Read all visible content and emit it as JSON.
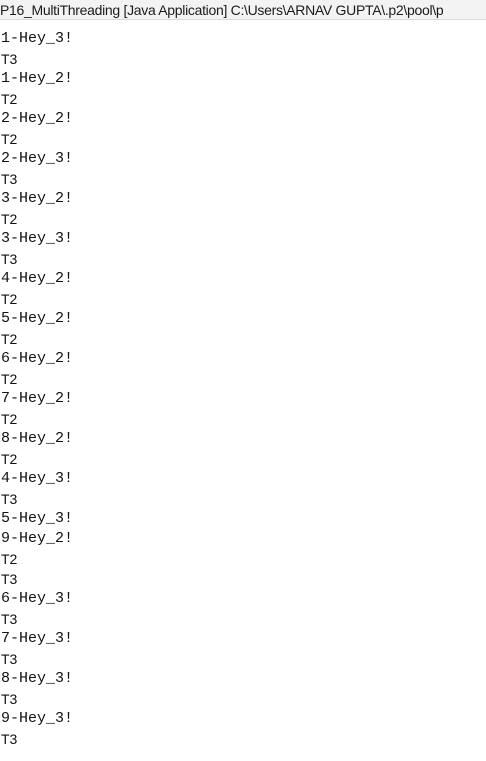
{
  "console": {
    "title": "P16_MultiThreading [Java Application] C:\\Users\\ARNAV GUPTA\\.p2\\pool\\p",
    "lines": [
      "1-Hey_3!",
      "T3",
      "1-Hey_2!",
      "T2",
      "2-Hey_2!",
      "T2",
      "2-Hey_3!",
      "T3",
      "3-Hey_2!",
      "T2",
      "3-Hey_3!",
      "T3",
      "4-Hey_2!",
      "T2",
      "5-Hey_2!",
      "T2",
      "6-Hey_2!",
      "T2",
      "7-Hey_2!",
      "T2",
      "8-Hey_2!",
      "T2",
      "4-Hey_3!",
      "T3",
      "5-Hey_3!",
      "9-Hey_2!",
      "T2",
      "T3",
      "6-Hey_3!",
      "T3",
      "7-Hey_3!",
      "T3",
      "8-Hey_3!",
      "T3",
      "9-Hey_3!",
      "T3"
    ]
  }
}
